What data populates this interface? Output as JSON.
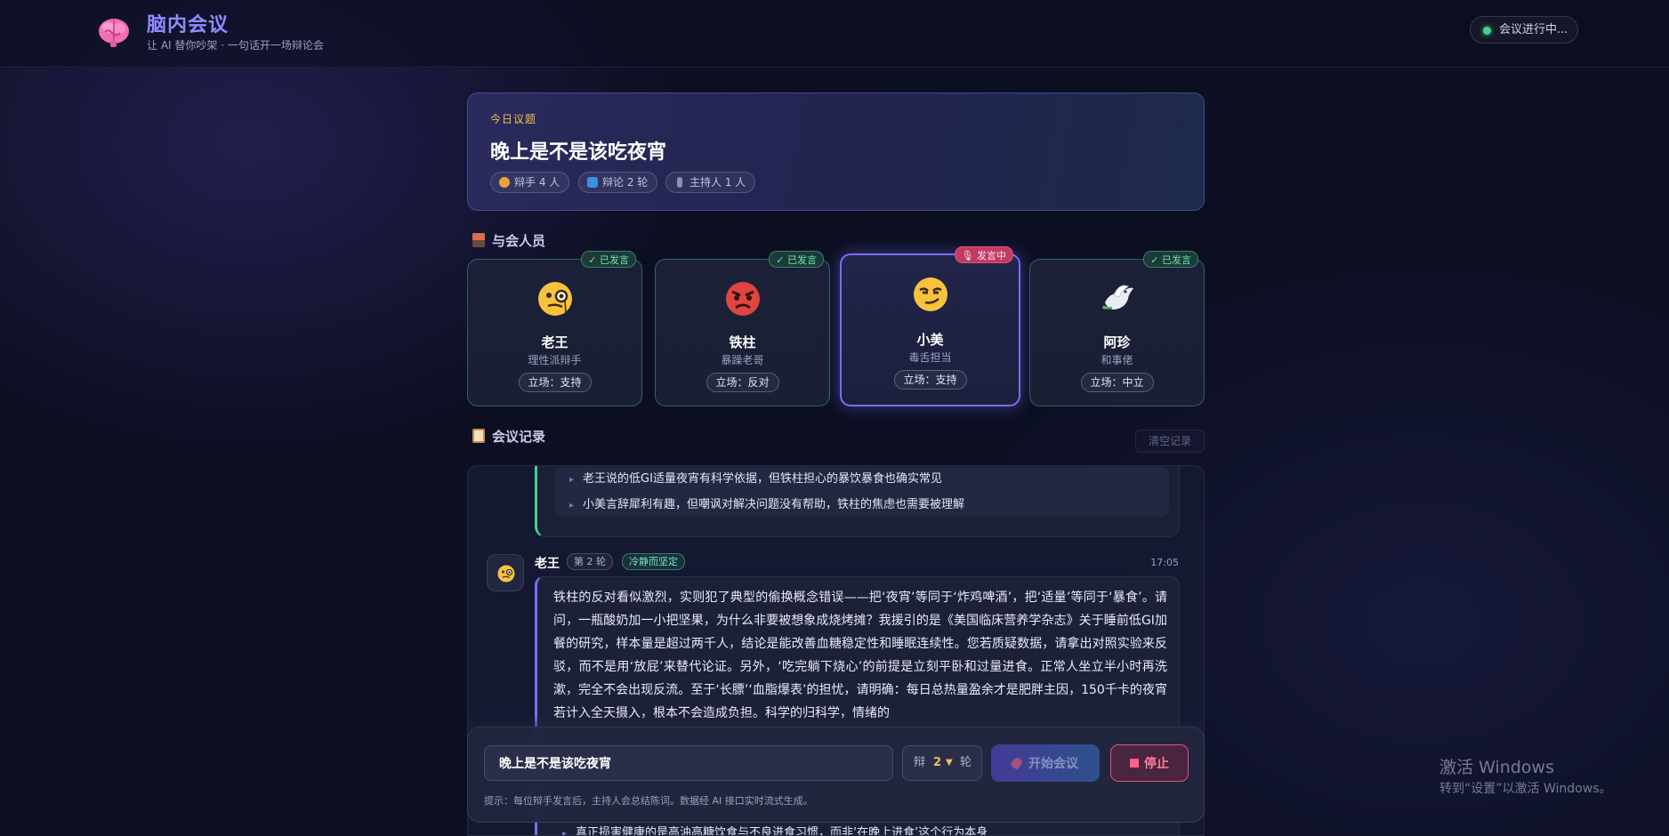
{
  "header": {
    "title": "脑内会议",
    "subtitle": "让 AI 替你吵架 · 一句话开一场辩论会",
    "status": "会议进行中..."
  },
  "topic": {
    "label": "今日议题",
    "title": "晚上是不是该吃夜宵",
    "chips": [
      "辩手 4 人",
      "辩论 2 轮",
      "主持人 1 人"
    ]
  },
  "participants_section": {
    "title": "与会人员",
    "items": [
      {
        "name": "老王",
        "role": "理性派辩手",
        "stance": "立场：支持",
        "badge": "✓ 已发言"
      },
      {
        "name": "铁柱",
        "role": "暴躁老哥",
        "stance": "立场：反对",
        "badge": "✓ 已发言"
      },
      {
        "name": "小美",
        "role": "毒舌担当",
        "stance": "立场：支持",
        "badge": "🎙 发言中"
      },
      {
        "name": "阿珍",
        "role": "和事佬",
        "stance": "立场：中立",
        "badge": "✓ 已发言"
      }
    ]
  },
  "log_section": {
    "title": "会议记录",
    "clear_label": "清空记录",
    "summary_bullets": [
      "老王说的低GI适量夜宵有科学依据，但铁柱担心的暴饮暴食也确实常见",
      "小美言辞犀利有趣，但嘲讽对解决问题没有帮助，铁柱的焦虑也需要被理解"
    ],
    "message": {
      "speaker": "老王",
      "round": "第 2 轮",
      "tone": "冷静而坚定",
      "time": "17:05",
      "text": "铁柱的反对看似激烈，实则犯了典型的偷换概念错误——把‘夜宵’等同于‘炸鸡啤酒’，把‘适量’等同于‘暴食’。请问，一瓶酸奶加一小把坚果，为什么非要被想象成烧烤摊？我援引的是《美国临床营养学杂志》关于睡前低GI加餐的研究，样本量是超过两千人，结论是能改善血糖稳定性和睡眠连续性。您若质疑数据，请拿出对照实验来反驳，而不是用‘放屁’来替代论证。另外，‘吃完躺下烧心’的前提是立刻平卧和过量进食。正常人坐立半小时再洗漱，完全不会出现反流。至于‘长膘’‘血脂爆表’的担忧，请明确：每日总热量盈余才是肥胖主因，150千卡的夜宵若计入全天摄入，根本不会造成负担。科学的归科学，情绪的"
    },
    "bottom_bullet": "真正损害健康的是高油高糖饮食与不良进食习惯，而非‘在晚上进食’这个行为本身"
  },
  "input_bar": {
    "topic_value": "晚上是不是该吃夜宵",
    "round_prefix": "辩",
    "round_value": "2",
    "round_suffix": "轮",
    "start_label": "开始会议",
    "stop_label": "停止",
    "tip": "提示：每位辩手发言后，主持人会总结陈词。数据经 AI 接口实时流式生成。"
  },
  "watermark": {
    "line1": "激活 Windows",
    "line2": "转到“设置”以激活 Windows。"
  },
  "colors": {
    "accent": "#7b6dff",
    "speaking": "#c23b63",
    "done": "#3fd68a",
    "topic_label": "#f2c14e"
  }
}
